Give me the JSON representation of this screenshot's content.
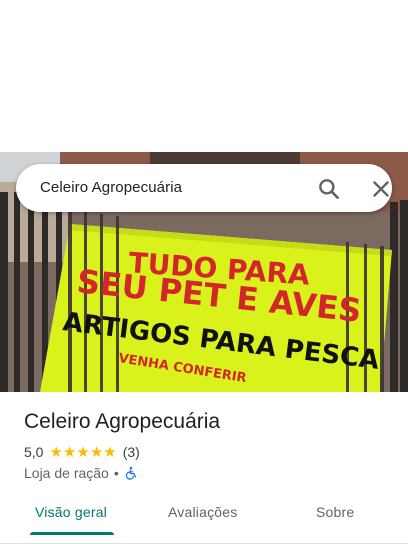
{
  "search": {
    "query": "Celeiro Agropecuária"
  },
  "photo": {
    "banner_lines": [
      "TUDO PARA",
      "SEU PET E AVES",
      "ARTIGOS PARA PESCA",
      "VENHA CONFERIR"
    ]
  },
  "place": {
    "name": "Celeiro Agropecuária",
    "rating": "5,0",
    "stars": 5,
    "review_count": "(3)",
    "category": "Loja de ração",
    "separator": "•"
  },
  "tabs": [
    {
      "label": "Visão geral",
      "active": true
    },
    {
      "label": "Avaliações",
      "active": false
    },
    {
      "label": "Sobre",
      "active": false
    }
  ],
  "colors": {
    "accent": "#00796b",
    "star": "#fbbc04",
    "banner": "#d9f21c",
    "banner_text_red": "#d3262a",
    "banner_text_black": "#111111",
    "wheelchair_icon": "#1a73e8"
  },
  "icons": {
    "search": "search-icon",
    "close": "close-icon",
    "accessibility": "wheelchair-icon"
  }
}
